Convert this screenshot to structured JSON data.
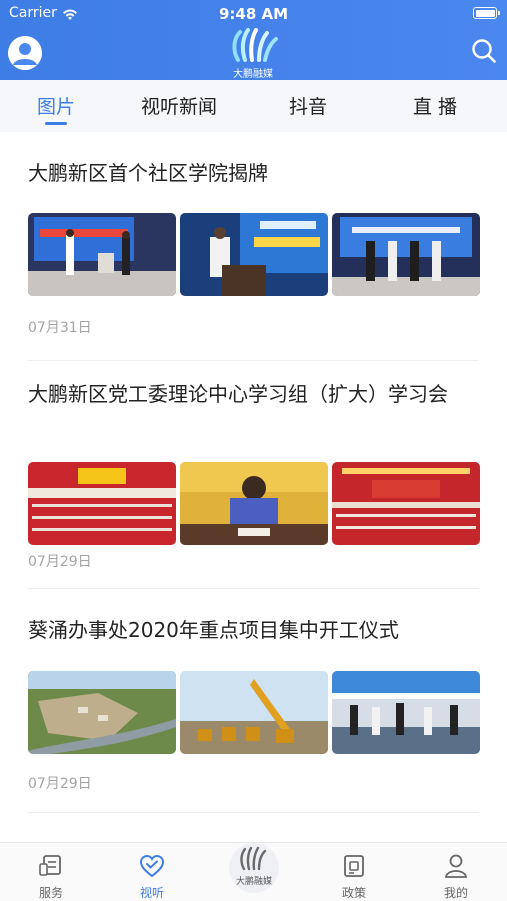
{
  "status_bar": {
    "carrier": "Carrier",
    "time": "9:48 AM"
  },
  "header": {
    "logo_text": "大鹏融媒"
  },
  "tabs": [
    {
      "label": "图片",
      "active": true
    },
    {
      "label": "视听新闻",
      "active": false
    },
    {
      "label": "抖音",
      "active": false
    },
    {
      "label": "直 播",
      "active": false
    }
  ],
  "articles": [
    {
      "title": "大鹏新区首个社区学院揭牌",
      "date": "07月31日",
      "images": [
        "stage-ceremony-photo",
        "speaker-podium-photo",
        "group-on-stage-photo"
      ]
    },
    {
      "title": "大鹏新区党工委理论中心学习组（扩大）学习会",
      "date": "07月29日",
      "images": [
        "meeting-hall-photo",
        "speaker-at-desk-photo",
        "conference-stage-photo"
      ]
    },
    {
      "title": "葵涌办事处2020年重点项目集中开工仪式",
      "date": "07月29日",
      "images": [
        "aerial-construction-site-photo",
        "excavators-photo",
        "ceremony-tent-photo"
      ]
    }
  ],
  "bottom_nav": [
    {
      "label": "服务",
      "icon": "service-icon",
      "active": false
    },
    {
      "label": "视听",
      "icon": "heart-icon",
      "active": true
    },
    {
      "label": "大鹏融媒",
      "icon": "center-logo-icon",
      "active": false
    },
    {
      "label": "政策",
      "icon": "policy-icon",
      "active": false
    },
    {
      "label": "我的",
      "icon": "person-icon",
      "active": false
    }
  ],
  "colors": {
    "accent": "#3f7de6",
    "header_bg": "#4a87ee",
    "date_text": "#a4a4a4"
  }
}
